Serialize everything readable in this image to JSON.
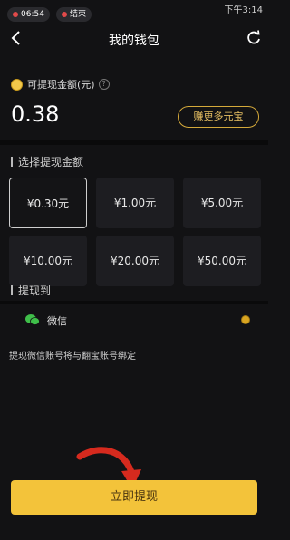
{
  "statusbar": {
    "time_pill": "06:54",
    "end_pill": "结束",
    "right_time": "下午3:14"
  },
  "nav": {
    "title": "我的钱包"
  },
  "balance": {
    "label": "可提现金额(元)",
    "help_symbol": "?",
    "value": "0.38",
    "earn_button": "赚更多元宝"
  },
  "select_amount": {
    "title": "选择提现金额",
    "options": [
      {
        "label": "¥0.30元",
        "selected": true
      },
      {
        "label": "¥1.00元",
        "selected": false
      },
      {
        "label": "¥5.00元",
        "selected": false
      },
      {
        "label": "¥10.00元",
        "selected": false
      },
      {
        "label": "¥20.00元",
        "selected": false
      },
      {
        "label": "¥50.00元",
        "selected": false
      }
    ]
  },
  "withdraw_to": {
    "title": "提现到",
    "method_label": "微信",
    "method_icon": "wechat-icon",
    "accent_color": "#d9a521"
  },
  "bind_note": "提现微信账号将与翻宝账号绑定",
  "action": {
    "withdraw_button": "立即提现",
    "button_color": "#f3c33a"
  }
}
